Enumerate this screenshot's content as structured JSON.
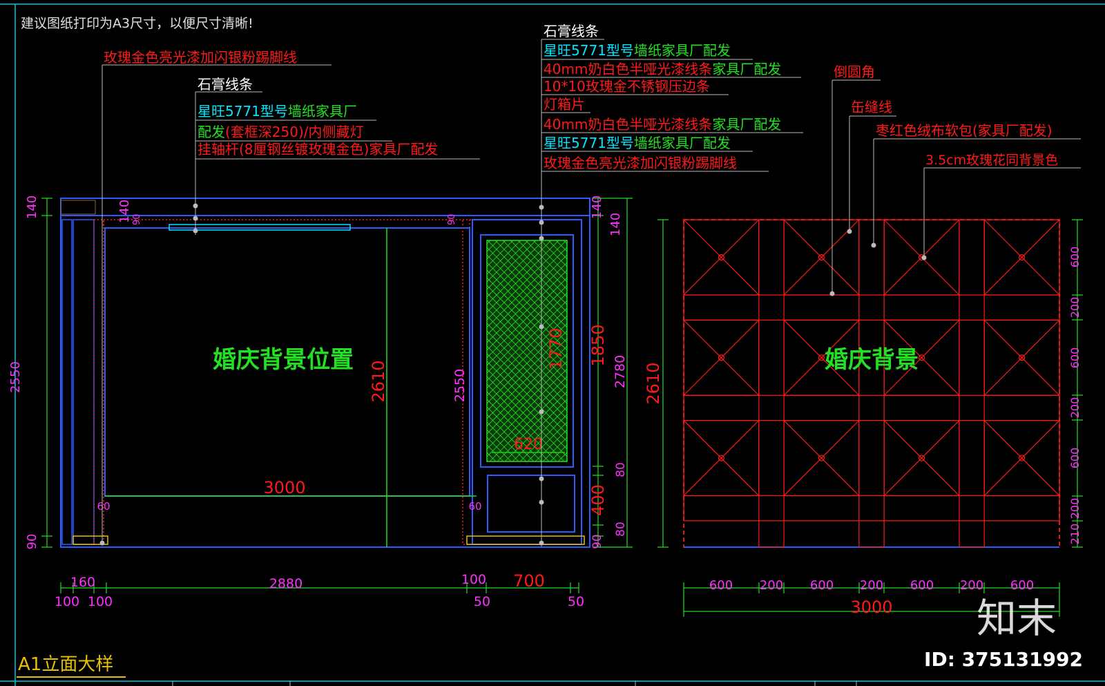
{
  "drawing": {
    "note": "建议图纸打印为A3尺寸，以便尺寸清晰!",
    "sheet_title": "A1立面大样",
    "colors": {
      "background": "#000000",
      "frame": "#00c8d8",
      "red": "#ff1a1a",
      "green": "#22e022",
      "magenta": "#ff30ff",
      "blue": "#2b5cff",
      "white": "#ffffff",
      "cyan": "#00e6ff",
      "yellow": "#e8c000"
    }
  },
  "left_callouts": {
    "skirting": "玫瑰金色亮光漆加闪银粉踢脚线",
    "gypsum": "石膏线条",
    "wallpaper_a": "星旺5771型号",
    "wallpaper_b": "墙纸家具厂",
    "frame_a": "配发",
    "frame_b": "(套框深250)/内侧藏灯",
    "rod": "挂轴杆(8厘钢丝镀玫瑰金色)家具厂配发"
  },
  "mid_callouts": {
    "gypsum": "石膏线条",
    "wallpaper1_a": "星旺5771型号",
    "wallpaper1_b": "墙纸家具厂配发",
    "line1_a": "40mm奶白色半哑光漆线条",
    "line1_b": "家具厂配发",
    "steel": "10*10玫瑰金不锈钢压边条",
    "mirror": "灯箱片",
    "line2_a": "40mm奶白色半哑光漆线条",
    "line2_b": "家具厂配发",
    "wallpaper2_a": "星旺5771型号",
    "wallpaper2_b": "墙纸家具厂配发",
    "skirting": "玫瑰金色亮光漆加闪银粉踢脚线"
  },
  "right_callouts": {
    "round_corner": "倒圆角",
    "seam": "缶缝线",
    "soft_pack": "枣红色绒布软包(家具厂配发)",
    "bg_color": "3.5cm玫瑰花同背景色"
  },
  "left_elevation": {
    "label": "婚庆背景位置",
    "dims": {
      "h2550_left": "2550",
      "top140": "140",
      "bot90": "90",
      "top140b": "140",
      "d90a": "90",
      "d90b": "90",
      "h2610": "2610",
      "h2550_mid": "2550",
      "w3000": "3000",
      "d60a": "60",
      "d60b": "60",
      "h1770": "1770",
      "w620": "620",
      "h1850": "1850",
      "h400": "400",
      "h80a": "80",
      "h80b": "80",
      "h140r": "140",
      "h140r2": "140",
      "h2780": "2780",
      "h90r": "90",
      "w160": "160",
      "w2880": "2880",
      "w100c": "100",
      "w700": "700",
      "w100a": "100",
      "w100b": "100",
      "w50a": "50",
      "w50b": "50"
    }
  },
  "right_elevation": {
    "label": "婚庆背景",
    "dims": {
      "h2610": "2610",
      "v600a": "600",
      "v200a": "200",
      "v600b": "600",
      "v200b": "200",
      "v600c": "600",
      "v200c": "200",
      "v210": "210",
      "w600a": "600",
      "w200a": "200",
      "w600b": "600",
      "w200b": "200",
      "w600c": "600",
      "w200c": "200",
      "w600d": "600",
      "w3000": "3000"
    }
  },
  "watermark": {
    "brand": "知末",
    "id": "ID: 375131992"
  }
}
